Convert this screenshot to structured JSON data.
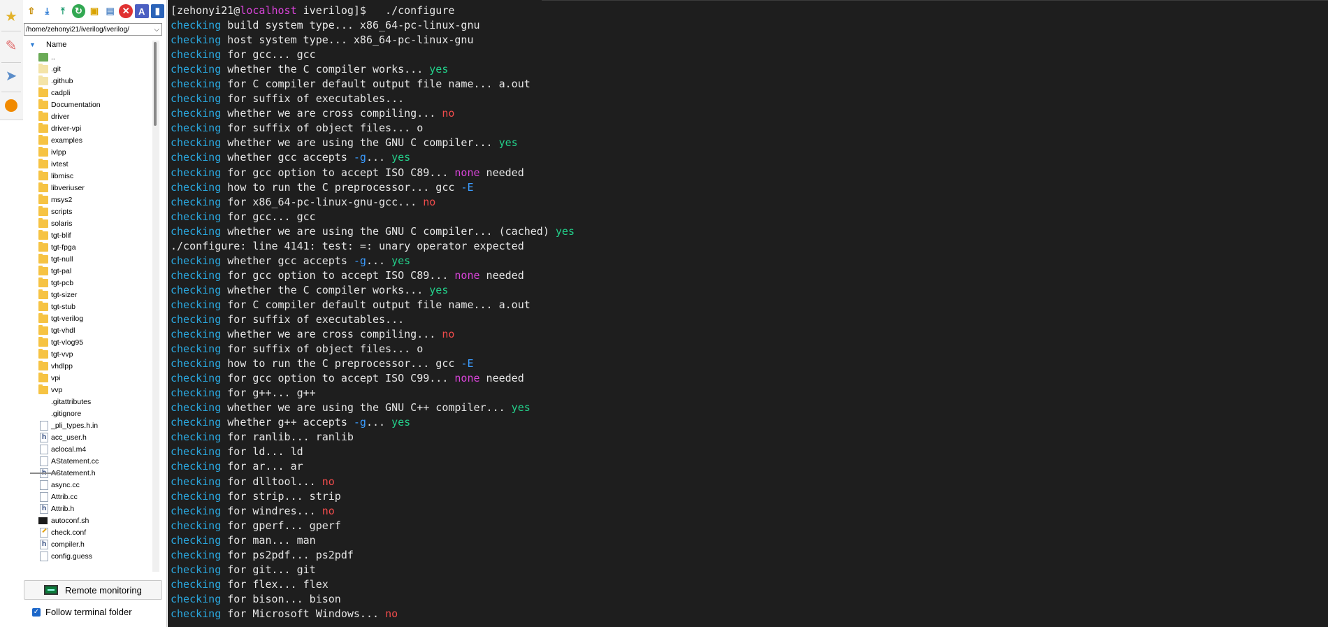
{
  "path": "/home/zehonyi21/iverilog/iverilog/",
  "tree_header": "Name",
  "files": [
    {
      "name": "..",
      "type": "up"
    },
    {
      "name": ".git",
      "type": "folder-light"
    },
    {
      "name": ".github",
      "type": "folder-light"
    },
    {
      "name": "cadpli",
      "type": "folder"
    },
    {
      "name": "Documentation",
      "type": "folder"
    },
    {
      "name": "driver",
      "type": "folder"
    },
    {
      "name": "driver-vpi",
      "type": "folder"
    },
    {
      "name": "examples",
      "type": "folder"
    },
    {
      "name": "ivlpp",
      "type": "folder"
    },
    {
      "name": "ivtest",
      "type": "folder"
    },
    {
      "name": "libmisc",
      "type": "folder"
    },
    {
      "name": "libveriuser",
      "type": "folder"
    },
    {
      "name": "msys2",
      "type": "folder"
    },
    {
      "name": "scripts",
      "type": "folder"
    },
    {
      "name": "solaris",
      "type": "folder"
    },
    {
      "name": "tgt-blif",
      "type": "folder"
    },
    {
      "name": "tgt-fpga",
      "type": "folder"
    },
    {
      "name": "tgt-null",
      "type": "folder"
    },
    {
      "name": "tgt-pal",
      "type": "folder"
    },
    {
      "name": "tgt-pcb",
      "type": "folder"
    },
    {
      "name": "tgt-sizer",
      "type": "folder"
    },
    {
      "name": "tgt-stub",
      "type": "folder"
    },
    {
      "name": "tgt-verilog",
      "type": "folder"
    },
    {
      "name": "tgt-vhdl",
      "type": "folder"
    },
    {
      "name": "tgt-vlog95",
      "type": "folder"
    },
    {
      "name": "tgt-vvp",
      "type": "folder"
    },
    {
      "name": "vhdlpp",
      "type": "folder"
    },
    {
      "name": "vpi",
      "type": "folder"
    },
    {
      "name": "vvp",
      "type": "folder"
    },
    {
      "name": ".gitattributes",
      "type": "blank"
    },
    {
      "name": ".gitignore",
      "type": "blank"
    },
    {
      "name": "_pli_types.h.in",
      "type": "file"
    },
    {
      "name": "acc_user.h",
      "type": "hfile"
    },
    {
      "name": "aclocal.m4",
      "type": "file"
    },
    {
      "name": "AStatement.cc",
      "type": "file"
    },
    {
      "name": "AStatement.h",
      "type": "hfile"
    },
    {
      "name": "async.cc",
      "type": "file"
    },
    {
      "name": "Attrib.cc",
      "type": "file"
    },
    {
      "name": "Attrib.h",
      "type": "hfile"
    },
    {
      "name": "autoconf.sh",
      "type": "sh"
    },
    {
      "name": "check.conf",
      "type": "conf"
    },
    {
      "name": "compiler.h",
      "type": "hfile"
    },
    {
      "name": "config.guess",
      "type": "file"
    }
  ],
  "remote_monitoring_label": "Remote monitoring",
  "follow_terminal_label": "Follow terminal folder",
  "terminal": {
    "prompt_user": "[zehonyi21@",
    "prompt_host": "localhost",
    "prompt_rest": " iverilog]$   ./configure",
    "lines": [
      [
        [
          "k",
          "checking"
        ],
        [
          "t",
          " build system type... x86_64-pc-linux-gnu"
        ]
      ],
      [
        [
          "k",
          "checking"
        ],
        [
          "t",
          " host system type... x86_64-pc-linux-gnu"
        ]
      ],
      [
        [
          "k",
          "checking"
        ],
        [
          "t",
          " for gcc... gcc"
        ]
      ],
      [
        [
          "k",
          "checking"
        ],
        [
          "t",
          " whether the C compiler works... "
        ],
        [
          "y",
          "yes"
        ]
      ],
      [
        [
          "k",
          "checking"
        ],
        [
          "t",
          " for C compiler default output file name... a.out"
        ]
      ],
      [
        [
          "k",
          "checking"
        ],
        [
          "t",
          " for suffix of executables..."
        ]
      ],
      [
        [
          "k",
          "checking"
        ],
        [
          "t",
          " whether we are cross compiling... "
        ],
        [
          "n",
          "no"
        ]
      ],
      [
        [
          "k",
          "checking"
        ],
        [
          "t",
          " for suffix of object files... o"
        ]
      ],
      [
        [
          "k",
          "checking"
        ],
        [
          "t",
          " whether we are using the GNU C compiler... "
        ],
        [
          "y",
          "yes"
        ]
      ],
      [
        [
          "k",
          "checking"
        ],
        [
          "t",
          " whether gcc accepts "
        ],
        [
          "b",
          "-g"
        ],
        [
          "t",
          "... "
        ],
        [
          "y",
          "yes"
        ]
      ],
      [
        [
          "k",
          "checking"
        ],
        [
          "t",
          " for gcc option to accept ISO C89... "
        ],
        [
          "m",
          "none"
        ],
        [
          "t",
          " needed"
        ]
      ],
      [
        [
          "k",
          "checking"
        ],
        [
          "t",
          " how to run the C preprocessor... gcc "
        ],
        [
          "b",
          "-E"
        ]
      ],
      [
        [
          "k",
          "checking"
        ],
        [
          "t",
          " for x86_64-pc-linux-gnu-gcc... "
        ],
        [
          "n",
          "no"
        ]
      ],
      [
        [
          "k",
          "checking"
        ],
        [
          "t",
          " for gcc... gcc"
        ]
      ],
      [
        [
          "k",
          "checking"
        ],
        [
          "t",
          " whether we are using the GNU C compiler... (cached) "
        ],
        [
          "y",
          "yes"
        ]
      ],
      [
        [
          "t",
          "./configure: line 4141: test: =: unary operator expected"
        ]
      ],
      [
        [
          "k",
          "checking"
        ],
        [
          "t",
          " whether gcc accepts "
        ],
        [
          "b",
          "-g"
        ],
        [
          "t",
          "... "
        ],
        [
          "y",
          "yes"
        ]
      ],
      [
        [
          "k",
          "checking"
        ],
        [
          "t",
          " for gcc option to accept ISO C89... "
        ],
        [
          "m",
          "none"
        ],
        [
          "t",
          " needed"
        ]
      ],
      [
        [
          "k",
          "checking"
        ],
        [
          "t",
          " whether the C compiler works... "
        ],
        [
          "y",
          "yes"
        ]
      ],
      [
        [
          "k",
          "checking"
        ],
        [
          "t",
          " for C compiler default output file name... a.out"
        ]
      ],
      [
        [
          "k",
          "checking"
        ],
        [
          "t",
          " for suffix of executables..."
        ]
      ],
      [
        [
          "k",
          "checking"
        ],
        [
          "t",
          " whether we are cross compiling... "
        ],
        [
          "n",
          "no"
        ]
      ],
      [
        [
          "k",
          "checking"
        ],
        [
          "t",
          " for suffix of object files... o"
        ]
      ],
      [
        [
          "k",
          "checking"
        ],
        [
          "t",
          " how to run the C preprocessor... gcc "
        ],
        [
          "b",
          "-E"
        ]
      ],
      [
        [
          "k",
          "checking"
        ],
        [
          "t",
          " for gcc option to accept ISO C99... "
        ],
        [
          "m",
          "none"
        ],
        [
          "t",
          " needed"
        ]
      ],
      [
        [
          "k",
          "checking"
        ],
        [
          "t",
          " for g++... g++"
        ]
      ],
      [
        [
          "k",
          "checking"
        ],
        [
          "t",
          " whether we are using the GNU C++ compiler... "
        ],
        [
          "y",
          "yes"
        ]
      ],
      [
        [
          "k",
          "checking"
        ],
        [
          "t",
          " whether g++ accepts "
        ],
        [
          "b",
          "-g"
        ],
        [
          "t",
          "... "
        ],
        [
          "y",
          "yes"
        ]
      ],
      [
        [
          "k",
          "checking"
        ],
        [
          "t",
          " for ranlib... ranlib"
        ]
      ],
      [
        [
          "k",
          "checking"
        ],
        [
          "t",
          " for ld... ld"
        ]
      ],
      [
        [
          "k",
          "checking"
        ],
        [
          "t",
          " for ar... ar"
        ]
      ],
      [
        [
          "k",
          "checking"
        ],
        [
          "t",
          " for dlltool... "
        ],
        [
          "n",
          "no"
        ]
      ],
      [
        [
          "k",
          "checking"
        ],
        [
          "t",
          " for strip... strip"
        ]
      ],
      [
        [
          "k",
          "checking"
        ],
        [
          "t",
          " for windres... "
        ],
        [
          "n",
          "no"
        ]
      ],
      [
        [
          "k",
          "checking"
        ],
        [
          "t",
          " for gperf... gperf"
        ]
      ],
      [
        [
          "k",
          "checking"
        ],
        [
          "t",
          " for man... man"
        ]
      ],
      [
        [
          "k",
          "checking"
        ],
        [
          "t",
          " for ps2pdf... ps2pdf"
        ]
      ],
      [
        [
          "k",
          "checking"
        ],
        [
          "t",
          " for git... git"
        ]
      ],
      [
        [
          "k",
          "checking"
        ],
        [
          "t",
          " for flex... flex"
        ]
      ],
      [
        [
          "k",
          "checking"
        ],
        [
          "t",
          " for bison... bison"
        ]
      ],
      [
        [
          "k",
          "checking"
        ],
        [
          "t",
          " for Microsoft Windows... "
        ],
        [
          "n",
          "no"
        ]
      ]
    ]
  }
}
